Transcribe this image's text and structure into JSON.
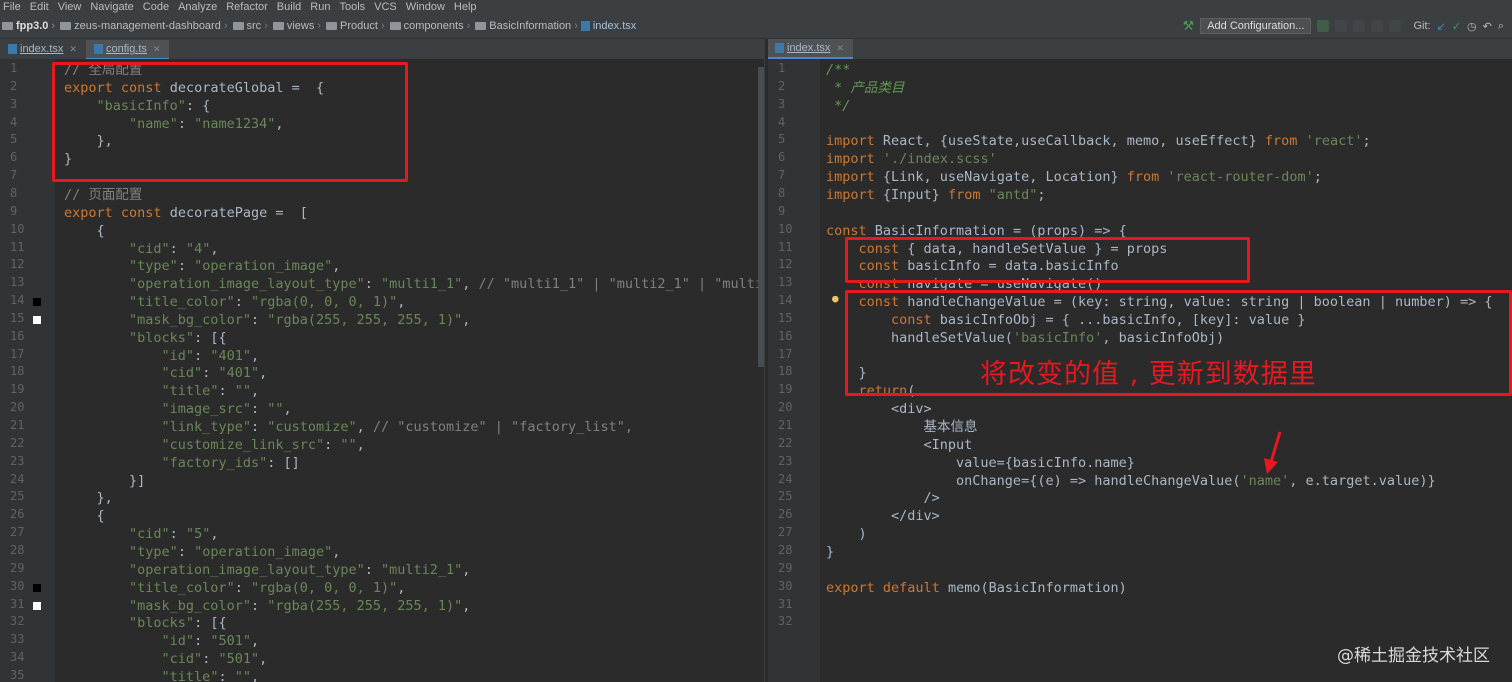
{
  "menu": [
    "File",
    "Edit",
    "View",
    "Navigate",
    "Code",
    "Analyze",
    "Refactor",
    "Build",
    "Run",
    "Tools",
    "VCS",
    "Window",
    "Help"
  ],
  "breadcrumbs": [
    "fpp3.0",
    "zeus-management-dashboard",
    "src",
    "views",
    "Product",
    "components",
    "BasicInformation",
    "index.tsx"
  ],
  "toolbar": {
    "add_config_label": "Add Configuration...",
    "git_label": "Git:"
  },
  "left_tabs": [
    "index.tsx",
    "config.ts"
  ],
  "right_tabs": [
    "index.tsx"
  ],
  "left_lines": [
    "// 全局配置",
    "export const decorateGlobal =  {",
    "    \"basicInfo\": {",
    "        \"name\": \"name1234\",",
    "    },",
    "}",
    "",
    "// 页面配置",
    "export const decoratePage =  [",
    "    {",
    "        \"cid\": \"4\",",
    "        \"type\": \"operation_image\",",
    "        \"operation_image_layout_type\": \"multi1_1\", // \"multi1_1\" | \"multi2_1\" | \"multi",
    "        \"title_color\": \"rgba(0, 0, 0, 1)\",",
    "        \"mask_bg_color\": \"rgba(255, 255, 255, 1)\",",
    "        \"blocks\": [{",
    "            \"id\": \"401\",",
    "            \"cid\": \"401\",",
    "            \"title\": \"\",",
    "            \"image_src\": \"\",",
    "            \"link_type\": \"customize\", // \"customize\" | \"factory_list\",",
    "            \"customize_link_src\": \"\",",
    "            \"factory_ids\": []",
    "        }]",
    "    },",
    "    {",
    "        \"cid\": \"5\",",
    "        \"type\": \"operation_image\",",
    "        \"operation_image_layout_type\": \"multi2_1\",",
    "        \"title_color\": \"rgba(0, 0, 0, 1)\",",
    "        \"mask_bg_color\": \"rgba(255, 255, 255, 1)\",",
    "        \"blocks\": [{",
    "            \"id\": \"501\",",
    "            \"cid\": \"501\",",
    "            \"title\": \"\","
  ],
  "right_lines": [
    "/**",
    " * 产品类目",
    " */",
    "",
    "import React, {useState,useCallback, memo, useEffect} from 'react';",
    "import './index.scss'",
    "import {Link, useNavigate, Location} from 'react-router-dom';",
    "import {Input} from \"antd\";",
    "",
    "const BasicInformation = (props) => {",
    "    const { data, handleSetValue } = props",
    "    const basicInfo = data.basicInfo",
    "    const navigate = useNavigate()",
    "    const handleChangeValue = (key: string, value: string | boolean | number) => {",
    "        const basicInfoObj = { ...basicInfo, [key]: value }",
    "        handleSetValue('basicInfo', basicInfoObj)",
    "",
    "    }",
    "    return(",
    "        <div>",
    "            基本信息",
    "            <Input",
    "                value={basicInfo.name}",
    "                onChange={(e) => handleChangeValue('name', e.target.value)}",
    "            />",
    "        </div>",
    "    )",
    "}",
    "",
    "export default memo(BasicInformation)",
    "",
    ""
  ],
  "annotation": "将改变的值 , 更新到数据里",
  "watermark": "@稀土掘金技术社区",
  "colors": {
    "keyword": "#cc7832",
    "string": "#6a8759",
    "comment": "#808080",
    "annotation_red": "#e8181f"
  }
}
